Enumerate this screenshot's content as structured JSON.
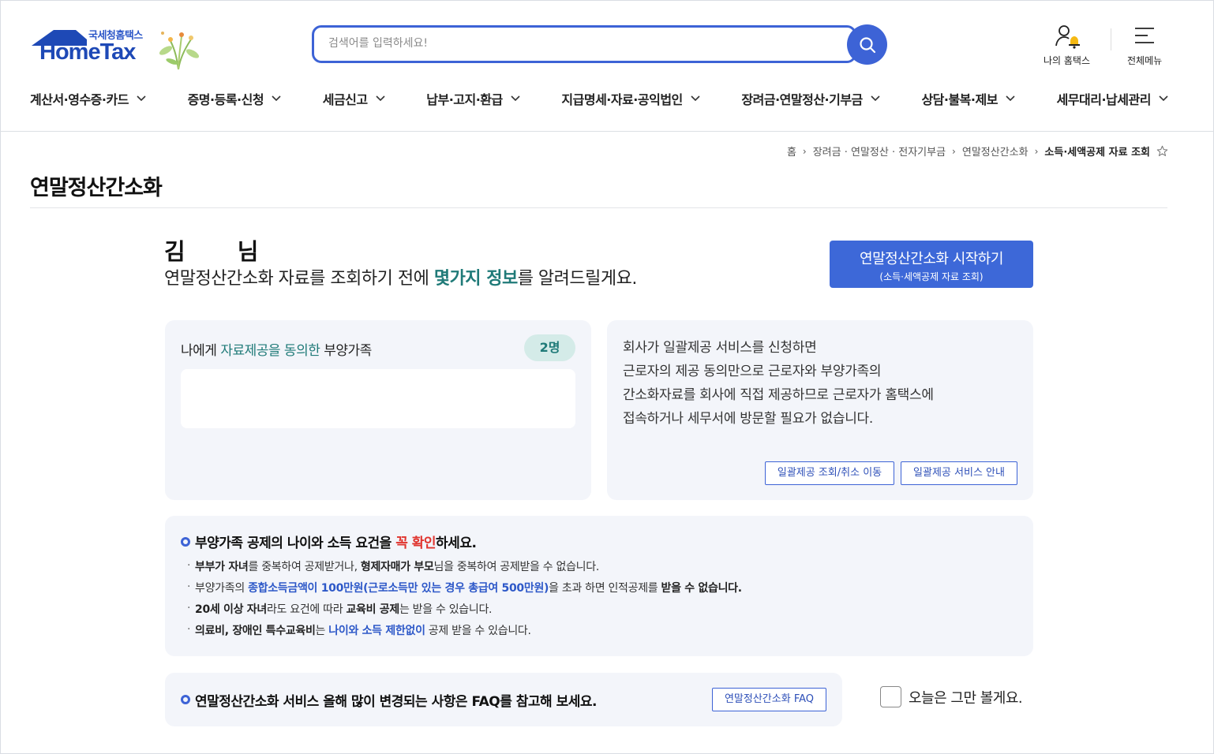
{
  "header": {
    "logo_sub": "국세청홈택스",
    "logo_main": "HomeTax",
    "search_placeholder": "검색어를 입력하세요!",
    "my_hometax": "나의 홈택스",
    "all_menu": "전체메뉴"
  },
  "gnb": [
    "계산서·영수증·카드",
    "증명·등록·신청",
    "세금신고",
    "납부·고지·환급",
    "지급명세·자료·공익법인",
    "장려금·연말정산·기부금",
    "상담·불복·제보",
    "세무대리·납세관리"
  ],
  "breadcrumb": {
    "home": "홈",
    "level1": "장려금 · 연말정산 · 전자기부금",
    "level2": "연말정산간소화",
    "current": "소득·세액공제 자료 조회"
  },
  "page_title": "연말정산간소화",
  "greeting": {
    "name": "김 님",
    "msg_before": "연말정산간소화 자료를 조회하기 전에 ",
    "msg_highlight": "몇가지 정보",
    "msg_after": "를 알려드릴게요."
  },
  "start_button": {
    "line1": "연말정산간소화 시작하기",
    "line2": "(소득·세액공제 자료 조회)"
  },
  "dependents_card": {
    "label_before": "나에게 ",
    "label_highlight": "자료제공을 동의한",
    "label_after": " 부양가족",
    "count": "2명"
  },
  "bulk_card": {
    "lines": [
      "회사가 일괄제공 서비스를 신청하면",
      "근로자의 제공 동의만으로 근로자와 부양가족의",
      "간소화자료를 회사에 직접 제공하므로 근로자가 홈택스에",
      "접속하거나 세무서에 방문할 필요가 없습니다."
    ],
    "btn_query": "일괄제공 조회/취소 이동",
    "btn_guide": "일괄제공 서비스 안내"
  },
  "notice": {
    "title_before": "부양가족 공제의 나이와 소득 요건을 ",
    "title_red": "꼭 확인",
    "title_after": "하세요.",
    "item1": {
      "b1": "부부가 자녀",
      "t1": "를 중복하여 공제받거나, ",
      "b2": "형제자매가 부모",
      "t2": "님을 중복하여 공제받을 수 없습니다."
    },
    "item2": {
      "t1": "부양가족의 ",
      "blue": "종합소득금액이 100만원(근로소득만 있는 경우 총급여 500만원)",
      "t2": "을 초과 하면 인적공제를 ",
      "b": "받을 수 없습니다."
    },
    "item3": {
      "b1": "20세 이상 자녀",
      "t1": "라도 요건에 따라 ",
      "b2": "교육비 공제",
      "t2": "는 받을 수 있습니다."
    },
    "item4": {
      "b": "의료비, 장애인 특수교육비",
      "t1": "는 ",
      "blue": "나이와 소득 제한없이",
      "t2": " 공제 받을 수 있습니다."
    }
  },
  "faq": {
    "text": "연말정산간소화 서비스 올해 많이 변경되는 사항은 FAQ를 참고해 보세요.",
    "button": "연말정산간소화 FAQ"
  },
  "dismiss_today": "오늘은 그만 볼게요.",
  "colors": {
    "brand_blue": "#3d63d6",
    "teal": "#1f7a78",
    "red": "#e0342e",
    "card_bg": "#f3f5fa"
  }
}
